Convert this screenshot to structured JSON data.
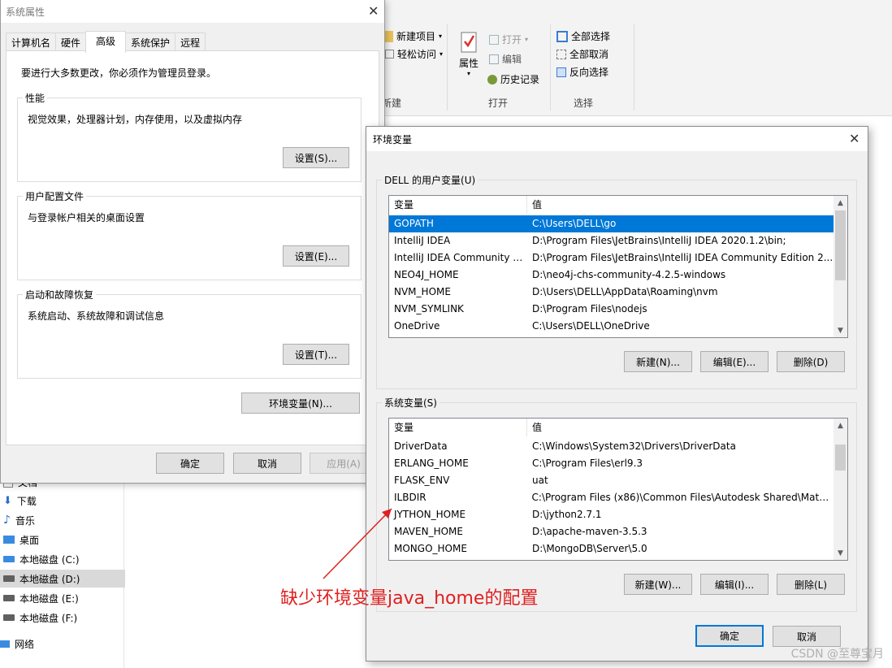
{
  "explorer": {
    "ribbon": {
      "new_item": "新建项目",
      "easy_access": "轻松访问",
      "group_new": "新建",
      "properties": "属性",
      "open": "打开",
      "edit": "编辑",
      "history": "历史记录",
      "group_open": "打开",
      "select_all": "全部选择",
      "select_none": "全部取消",
      "invert_selection": "反向选择",
      "group_select": "选择"
    },
    "nav": [
      {
        "label": "文档",
        "icon": "document-icon"
      },
      {
        "label": "下载",
        "icon": "download-icon"
      },
      {
        "label": "音乐",
        "icon": "music-icon"
      },
      {
        "label": "桌面",
        "icon": "desktop-icon"
      },
      {
        "label": "本地磁盘 (C:)",
        "icon": "drive-icon"
      },
      {
        "label": "本地磁盘 (D:)",
        "icon": "drive-icon",
        "selected": true
      },
      {
        "label": "本地磁盘 (E:)",
        "icon": "drive-icon"
      },
      {
        "label": "本地磁盘 (F:)",
        "icon": "drive-icon"
      },
      {
        "label": "网络",
        "icon": "network-icon"
      }
    ]
  },
  "sysprop": {
    "title": "系统属性",
    "tabs": [
      "计算机名",
      "硬件",
      "高级",
      "系统保护",
      "远程"
    ],
    "admin_note": "要进行大多数更改，你必须作为管理员登录。",
    "performance": {
      "title": "性能",
      "desc": "视觉效果，处理器计划，内存使用，以及虚拟内存",
      "button": "设置(S)..."
    },
    "profiles": {
      "title": "用户配置文件",
      "desc": "与登录帐户相关的桌面设置",
      "button": "设置(E)..."
    },
    "startup": {
      "title": "启动和故障恢复",
      "desc": "系统启动、系统故障和调试信息",
      "button": "设置(T)..."
    },
    "env_button": "环境变量(N)...",
    "ok": "确定",
    "cancel": "取消",
    "apply": "应用(A)"
  },
  "envdlg": {
    "title": "环境变量",
    "user_group": "DELL 的用户变量(U)",
    "col_var": "变量",
    "col_val": "值",
    "user_vars": [
      {
        "name": "GOPATH",
        "value": "C:\\Users\\DELL\\go",
        "selected": true
      },
      {
        "name": "IntelliJ IDEA",
        "value": "D:\\Program Files\\JetBrains\\IntelliJ IDEA 2020.1.2\\bin;"
      },
      {
        "name": "IntelliJ IDEA Community E...",
        "value": "D:\\Program Files\\JetBrains\\IntelliJ IDEA Community Edition 2..."
      },
      {
        "name": "NEO4J_HOME",
        "value": "D:\\neo4j-chs-community-4.2.5-windows"
      },
      {
        "name": "NVM_HOME",
        "value": "D:\\Users\\DELL\\AppData\\Roaming\\nvm"
      },
      {
        "name": "NVM_SYMLINK",
        "value": "D:\\Program Files\\nodejs"
      },
      {
        "name": "OneDrive",
        "value": "C:\\Users\\DELL\\OneDrive"
      }
    ],
    "user_new": "新建(N)...",
    "user_edit": "编辑(E)...",
    "user_delete": "删除(D)",
    "sys_group": "系统变量(S)",
    "sys_vars": [
      {
        "name": "DriverData",
        "value": "C:\\Windows\\System32\\Drivers\\DriverData"
      },
      {
        "name": "ERLANG_HOME",
        "value": "C:\\Program Files\\erl9.3"
      },
      {
        "name": "FLASK_ENV",
        "value": "uat"
      },
      {
        "name": "ILBDIR",
        "value": "C:\\Program Files (x86)\\Common Files\\Autodesk Shared\\Mate..."
      },
      {
        "name": "JYTHON_HOME",
        "value": "D:\\jython2.7.1"
      },
      {
        "name": "MAVEN_HOME",
        "value": "D:\\apache-maven-3.5.3"
      },
      {
        "name": "MONGO_HOME",
        "value": "D:\\MongoDB\\Server\\5.0"
      }
    ],
    "sys_new": "新建(W)...",
    "sys_edit": "编辑(I)...",
    "sys_delete": "删除(L)",
    "ok": "确定",
    "cancel": "取消"
  },
  "annotation": "缺少环境变量java_home的配置",
  "watermark": "CSDN @至尊宝月",
  "colors": {
    "selection": "#0078d7",
    "annotation": "#e02020",
    "dialog_bg": "#f0f0f0"
  }
}
